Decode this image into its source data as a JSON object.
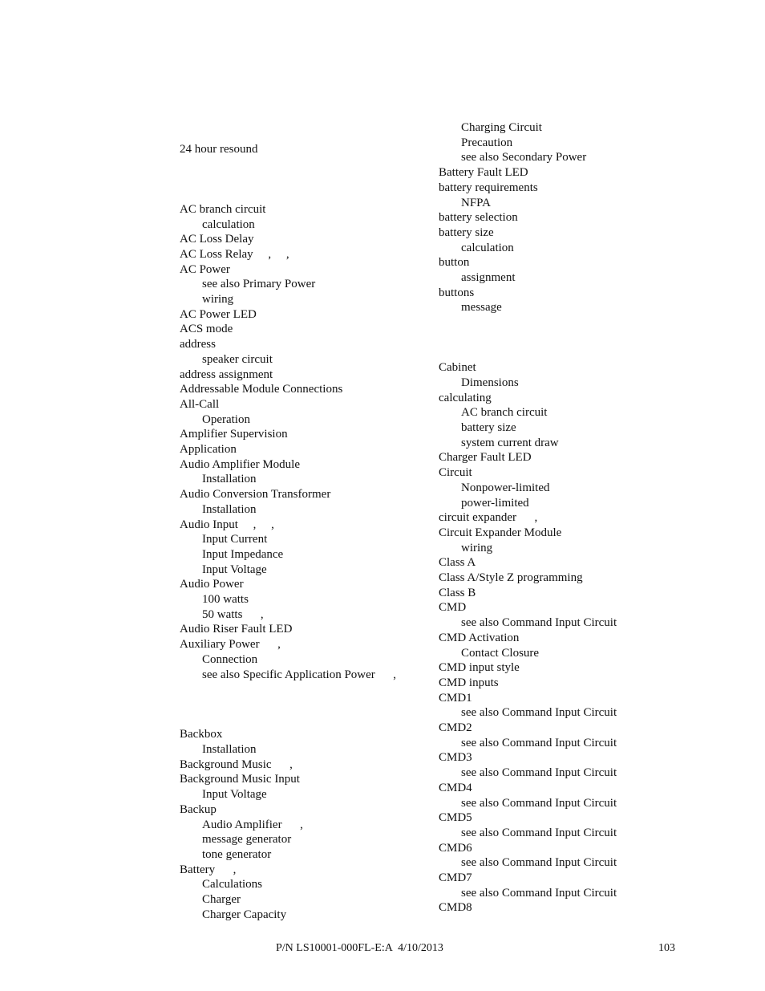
{
  "index": {
    "left_column": [
      {
        "text": "24 hour resound",
        "level": 0,
        "suffix": ""
      },
      {
        "gap": 2
      },
      {
        "text": "AC branch circuit",
        "level": 0,
        "suffix": ""
      },
      {
        "text": "calculation",
        "level": 1,
        "suffix": ""
      },
      {
        "text": "AC Loss Delay",
        "level": 0,
        "suffix": ""
      },
      {
        "text": "AC Loss Relay",
        "level": 0,
        "suffix": "     ,     ,"
      },
      {
        "text": "AC Power",
        "level": 0,
        "suffix": ""
      },
      {
        "text": "see also Primary Power",
        "level": 1,
        "suffix": ""
      },
      {
        "text": "wiring",
        "level": 1,
        "suffix": ""
      },
      {
        "text": "AC Power LED",
        "level": 0,
        "suffix": ""
      },
      {
        "text": "ACS mode",
        "level": 0,
        "suffix": ""
      },
      {
        "text": "address",
        "level": 0,
        "suffix": ""
      },
      {
        "text": "speaker circuit",
        "level": 1,
        "suffix": ""
      },
      {
        "text": "address assignment",
        "level": 0,
        "suffix": ""
      },
      {
        "text": "Addressable Module Connections",
        "level": 0,
        "suffix": ""
      },
      {
        "text": "All-Call",
        "level": 0,
        "suffix": ""
      },
      {
        "text": "Operation",
        "level": 1,
        "suffix": ""
      },
      {
        "text": "Amplifier Supervision",
        "level": 0,
        "suffix": ""
      },
      {
        "text": "Application",
        "level": 0,
        "suffix": ""
      },
      {
        "text": "Audio Amplifier Module",
        "level": 0,
        "suffix": ""
      },
      {
        "text": "Installation",
        "level": 1,
        "suffix": ""
      },
      {
        "text": "Audio Conversion Transformer",
        "level": 0,
        "suffix": ""
      },
      {
        "text": "Installation",
        "level": 1,
        "suffix": ""
      },
      {
        "text": "Audio Input",
        "level": 0,
        "suffix": "     ,     ,"
      },
      {
        "text": "Input Current",
        "level": 1,
        "suffix": ""
      },
      {
        "text": "Input Impedance",
        "level": 1,
        "suffix": ""
      },
      {
        "text": "Input Voltage",
        "level": 1,
        "suffix": ""
      },
      {
        "text": "Audio Power",
        "level": 0,
        "suffix": ""
      },
      {
        "text": "100 watts",
        "level": 1,
        "suffix": ""
      },
      {
        "text": "50 watts",
        "level": 1,
        "suffix": "      ,"
      },
      {
        "text": "Audio Riser Fault LED",
        "level": 0,
        "suffix": ""
      },
      {
        "text": "Auxiliary Power",
        "level": 0,
        "suffix": "      ,"
      },
      {
        "text": "Connection",
        "level": 1,
        "suffix": ""
      },
      {
        "text": "see also Specific Application Power",
        "level": 1,
        "suffix": "      ,"
      },
      {
        "gap": 2
      },
      {
        "text": "Backbox",
        "level": 0,
        "suffix": ""
      },
      {
        "text": "Installation",
        "level": 1,
        "suffix": ""
      },
      {
        "text": "Background Music",
        "level": 0,
        "suffix": "      ,"
      },
      {
        "text": "Background Music Input",
        "level": 0,
        "suffix": ""
      },
      {
        "text": "Input Voltage",
        "level": 1,
        "suffix": ""
      },
      {
        "text": "Backup",
        "level": 0,
        "suffix": ""
      },
      {
        "text": "Audio Amplifier",
        "level": 1,
        "suffix": "      ,"
      },
      {
        "text": "message generator",
        "level": 1,
        "suffix": ""
      },
      {
        "text": "tone generator",
        "level": 1,
        "suffix": ""
      },
      {
        "text": "Battery",
        "level": 0,
        "suffix": "      ,"
      },
      {
        "text": "Calculations",
        "level": 1,
        "suffix": ""
      },
      {
        "text": "Charger",
        "level": 1,
        "suffix": ""
      },
      {
        "text": "Charger Capacity",
        "level": 1,
        "suffix": ""
      }
    ],
    "right_column": [
      {
        "text": "Charging Circuit",
        "level": 1,
        "suffix": ""
      },
      {
        "text": "Precaution",
        "level": 1,
        "suffix": ""
      },
      {
        "text": "see also Secondary Power",
        "level": 1,
        "suffix": ""
      },
      {
        "text": "Battery Fault LED",
        "level": 0,
        "suffix": ""
      },
      {
        "text": "battery requirements",
        "level": 0,
        "suffix": ""
      },
      {
        "text": "NFPA",
        "level": 1,
        "suffix": ""
      },
      {
        "text": "battery selection",
        "level": 0,
        "suffix": ""
      },
      {
        "text": "battery size",
        "level": 0,
        "suffix": ""
      },
      {
        "text": "calculation",
        "level": 1,
        "suffix": ""
      },
      {
        "text": "button",
        "level": 0,
        "suffix": ""
      },
      {
        "text": "assignment",
        "level": 1,
        "suffix": ""
      },
      {
        "text": "buttons",
        "level": 0,
        "suffix": ""
      },
      {
        "text": "message",
        "level": 1,
        "suffix": ""
      },
      {
        "gap": 2
      },
      {
        "text": "Cabinet",
        "level": 0,
        "suffix": ""
      },
      {
        "text": "Dimensions",
        "level": 1,
        "suffix": ""
      },
      {
        "text": "calculating",
        "level": 0,
        "suffix": ""
      },
      {
        "text": "AC branch circuit",
        "level": 1,
        "suffix": ""
      },
      {
        "text": "battery size",
        "level": 1,
        "suffix": ""
      },
      {
        "text": "system current draw",
        "level": 1,
        "suffix": ""
      },
      {
        "text": "Charger Fault LED",
        "level": 0,
        "suffix": ""
      },
      {
        "text": "Circuit",
        "level": 0,
        "suffix": ""
      },
      {
        "text": "Nonpower-limited",
        "level": 1,
        "suffix": ""
      },
      {
        "text": "power-limited",
        "level": 1,
        "suffix": ""
      },
      {
        "text": "circuit expander",
        "level": 0,
        "suffix": "      ,"
      },
      {
        "text": "Circuit Expander Module",
        "level": 0,
        "suffix": ""
      },
      {
        "text": "wiring",
        "level": 1,
        "suffix": ""
      },
      {
        "text": "Class A",
        "level": 0,
        "suffix": ""
      },
      {
        "text": "Class A/Style Z programming",
        "level": 0,
        "suffix": ""
      },
      {
        "text": "Class B",
        "level": 0,
        "suffix": ""
      },
      {
        "text": "CMD",
        "level": 0,
        "suffix": ""
      },
      {
        "text": "see also Command Input Circuit",
        "level": 1,
        "suffix": ""
      },
      {
        "text": "CMD Activation",
        "level": 0,
        "suffix": ""
      },
      {
        "text": "Contact Closure",
        "level": 1,
        "suffix": ""
      },
      {
        "text": "CMD input style",
        "level": 0,
        "suffix": ""
      },
      {
        "text": "CMD inputs",
        "level": 0,
        "suffix": ""
      },
      {
        "text": "CMD1",
        "level": 0,
        "suffix": ""
      },
      {
        "text": "see also Command Input Circuit",
        "level": 1,
        "suffix": ""
      },
      {
        "text": "CMD2",
        "level": 0,
        "suffix": ""
      },
      {
        "text": "see also Command Input Circuit",
        "level": 1,
        "suffix": ""
      },
      {
        "text": "CMD3",
        "level": 0,
        "suffix": ""
      },
      {
        "text": "see also Command Input Circuit",
        "level": 1,
        "suffix": ""
      },
      {
        "text": "CMD4",
        "level": 0,
        "suffix": ""
      },
      {
        "text": "see also Command Input Circuit",
        "level": 1,
        "suffix": ""
      },
      {
        "text": "CMD5",
        "level": 0,
        "suffix": ""
      },
      {
        "text": "see also Command Input Circuit",
        "level": 1,
        "suffix": ""
      },
      {
        "text": "CMD6",
        "level": 0,
        "suffix": ""
      },
      {
        "text": "see also Command Input Circuit",
        "level": 1,
        "suffix": ""
      },
      {
        "text": "CMD7",
        "level": 0,
        "suffix": ""
      },
      {
        "text": "see also Command Input Circuit",
        "level": 1,
        "suffix": ""
      },
      {
        "text": "CMD8",
        "level": 0,
        "suffix": ""
      }
    ]
  },
  "footer": {
    "part_number": "P/N LS10001-000FL-E:A  4/10/2013",
    "page_number": "103"
  }
}
